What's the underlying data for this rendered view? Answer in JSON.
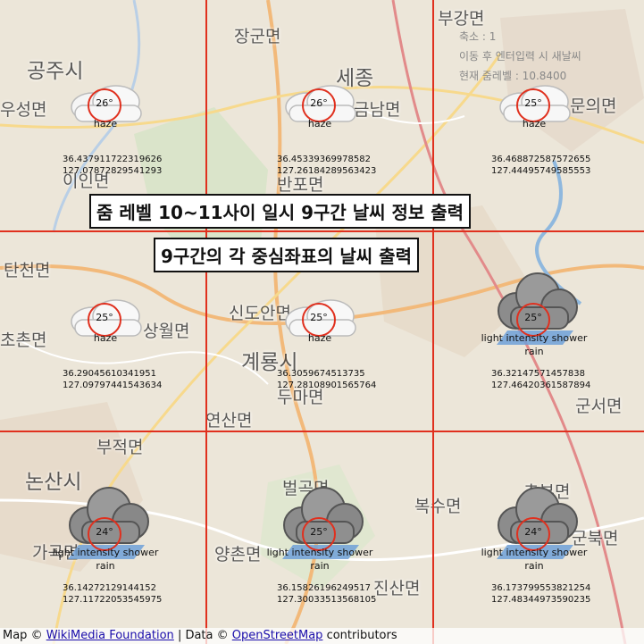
{
  "map": {
    "places": [
      {
        "name": "공주시",
        "cls": "big"
      },
      {
        "name": "우성면",
        "cls": "mid"
      },
      {
        "name": "장군면",
        "cls": "mid"
      },
      {
        "name": "세종",
        "cls": "big"
      },
      {
        "name": "금남면",
        "cls": "mid"
      },
      {
        "name": "부강면",
        "cls": "mid"
      },
      {
        "name": "신도안면",
        "cls": "mid"
      },
      {
        "name": "상월면",
        "cls": "mid"
      },
      {
        "name": "계룡시",
        "cls": "big"
      },
      {
        "name": "두마면",
        "cls": "mid"
      },
      {
        "name": "연산면",
        "cls": "mid"
      },
      {
        "name": "부적면",
        "cls": "mid"
      },
      {
        "name": "논산시",
        "cls": "big"
      },
      {
        "name": "벌곡면",
        "cls": "mid"
      },
      {
        "name": "양촌면",
        "cls": "mid"
      },
      {
        "name": "진산면",
        "cls": "mid"
      },
      {
        "name": "복수면",
        "cls": "mid"
      },
      {
        "name": "추부면",
        "cls": "mid"
      },
      {
        "name": "군서면",
        "cls": "mid"
      },
      {
        "name": "탄천면",
        "cls": "mid"
      },
      {
        "name": "초촌면",
        "cls": "mid"
      },
      {
        "name": "문의면",
        "cls": "mid"
      },
      {
        "name": "가곡면",
        "cls": "mid"
      },
      {
        "name": "군북면",
        "cls": "mid"
      },
      {
        "name": "이인면",
        "cls": "mid"
      },
      {
        "name": "반포면",
        "cls": "mid"
      }
    ]
  },
  "info": {
    "scale": "축소 : 1",
    "hint": "이동 후 엔터입력 시 새날씨",
    "zoom": "현재 줌레벨 : 10.8400"
  },
  "banners": {
    "title": "줌 레벨 10~11사이 일시 9구간 날씨 정보 출력",
    "subtitle": "9구간의 각 중심좌표의 날씨 출력"
  },
  "cells": [
    {
      "temp": "26°",
      "desc": "haze",
      "lat": "36.437911722319626",
      "lon": "127.07872829541293",
      "type": "haze"
    },
    {
      "temp": "26°",
      "desc": "haze",
      "lat": "36.45339369978582",
      "lon": "127.26184289563423",
      "type": "haze"
    },
    {
      "temp": "25°",
      "desc": "haze",
      "lat": "36.468872587572655",
      "lon": "127.44495749585553",
      "type": "haze"
    },
    {
      "temp": "25°",
      "desc": "haze",
      "lat": "36.29045610341951",
      "lon": "127.09797441543634",
      "type": "haze"
    },
    {
      "temp": "25°",
      "desc": "haze",
      "lat": "36.3059674513735",
      "lon": "127.28108901565764",
      "type": "haze"
    },
    {
      "temp": "25°",
      "desc": "light intensity shower rain",
      "lat": "36.32147571457838",
      "lon": "127.46420361587894",
      "type": "rain"
    },
    {
      "temp": "24°",
      "desc": "light intensity shower rain",
      "lat": "36.14272129144152",
      "lon": "127.11722053545975",
      "type": "rain"
    },
    {
      "temp": "25°",
      "desc": "light intensity shower rain",
      "lat": "36.15826196249517",
      "lon": "127.30033513568105",
      "type": "rain"
    },
    {
      "temp": "24°",
      "desc": "light intensity shower rain",
      "lat": "36.173799553821254",
      "lon": "127.48344973590235",
      "type": "rain"
    }
  ],
  "attribution": {
    "prefix": "Map ©",
    "wikimedia": "WikiMedia Foundation",
    "data": "| Data ©",
    "osm": "OpenStreetMap",
    "suffix": "contributors"
  },
  "colors": {
    "grid": "#e0301e",
    "ring": "#e0301e",
    "link": "#1a0dab"
  }
}
